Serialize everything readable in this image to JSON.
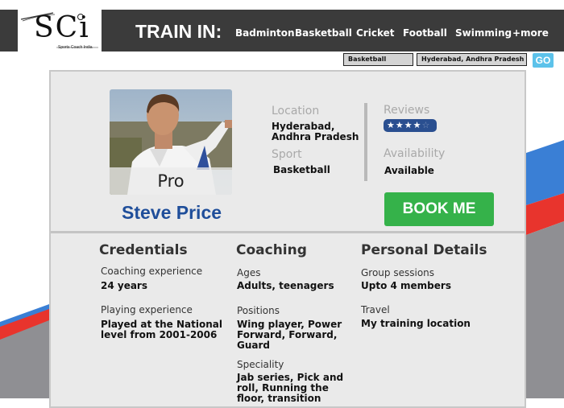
{
  "logo": {
    "text": "SCi",
    "tagline": "Sports Coach India"
  },
  "header": {
    "train_label": "TRAIN IN:",
    "sports": [
      "Badminton",
      "Basketball",
      "Cricket",
      "Football",
      "Swimming"
    ],
    "more": "+more"
  },
  "search": {
    "sport_value": "Basketball",
    "location_value": "Hyderabad, Andhra Pradesh",
    "go_label": "GO"
  },
  "profile": {
    "badge": "Pro",
    "name": "Steve Price",
    "location_label": "Location",
    "location_value": "Hyderabad,\nAndhra Pradesh",
    "sport_label": "Sport",
    "sport_value": "Basketball",
    "reviews_label": "Reviews",
    "rating": 4,
    "rating_max": 5,
    "availability_label": "Availability",
    "availability_value": "Available",
    "book_label": "BOOK ME"
  },
  "credentials": {
    "title": "Credentials",
    "exp_label": "Coaching experience",
    "exp_value": "24 years",
    "play_label": "Playing experience",
    "play_value": "Played at the National\nlevel from 2001-2006"
  },
  "coaching": {
    "title": "Coaching",
    "ages_label": "Ages",
    "ages_value": "Adults, teenagers",
    "positions_label": "Positions",
    "positions_value": "Wing player, Power\nForward, Forward,\nGuard",
    "speciality_label": "Speciality",
    "speciality_value": "Jab series, Pick and\nroll, Running the\nfloor, transition"
  },
  "personal": {
    "title": "Personal Details",
    "group_label": "Group sessions",
    "group_value": "Upto 4 members",
    "travel_label": "Travel",
    "travel_value": "My training location"
  },
  "colors": {
    "accent_blue": "#1f4e9a",
    "book_green": "#35b24a",
    "go_blue": "#5cc2ea",
    "header": "#3b3b3b",
    "stripe_red": "#e8342d",
    "stripe_blue": "#3a7fd5"
  }
}
